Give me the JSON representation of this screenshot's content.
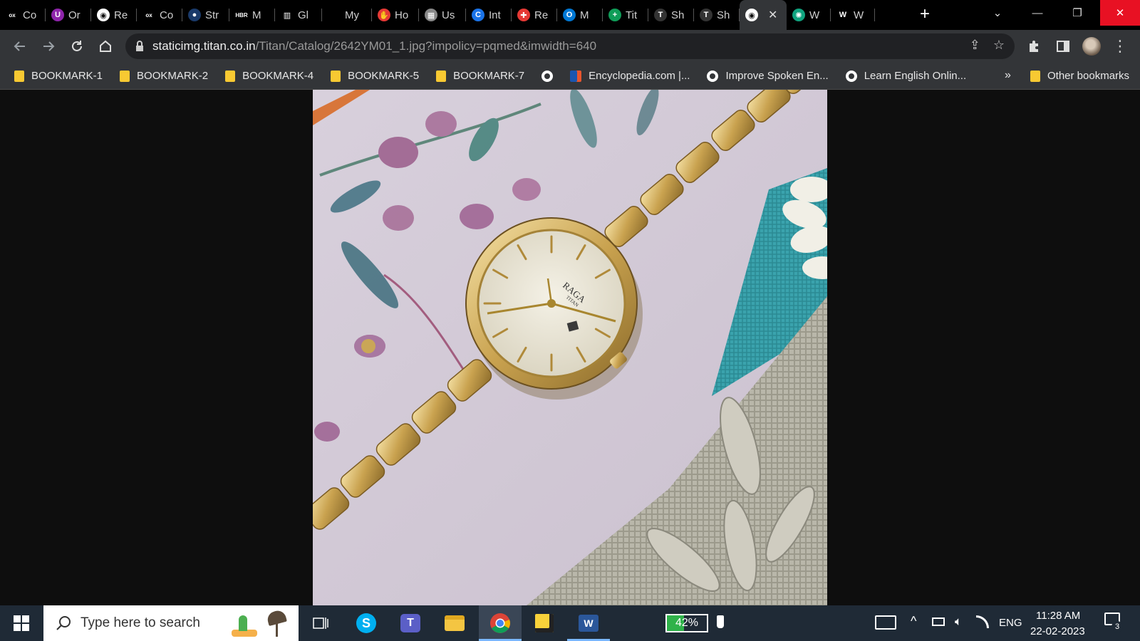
{
  "tabs": [
    {
      "label": "Co",
      "icon": "ox-icon",
      "color": "#000000"
    },
    {
      "label": "Or",
      "icon": "u-icon",
      "color": "#8e24aa"
    },
    {
      "label": "Re",
      "icon": "globe-icon",
      "color": "#ffffff"
    },
    {
      "label": "Co",
      "icon": "ox-icon",
      "color": "#000000"
    },
    {
      "label": "Str",
      "icon": "dot-icon",
      "color": "#1a3a6a"
    },
    {
      "label": "M",
      "icon": "hbr-icon",
      "color": "#000000"
    },
    {
      "label": "Gl",
      "icon": "building-icon",
      "color": "#000000"
    },
    {
      "label": "My",
      "icon": "blank-icon",
      "color": "#000000"
    },
    {
      "label": "Ho",
      "icon": "hand-icon",
      "color": "#e53935"
    },
    {
      "label": "Us",
      "icon": "image-icon",
      "color": "#888888"
    },
    {
      "label": "Int",
      "icon": "c-icon",
      "color": "#1a73e8"
    },
    {
      "label": "Re",
      "icon": "cross-icon",
      "color": "#e53935"
    },
    {
      "label": "M",
      "icon": "outlook-icon",
      "color": "#0078d4"
    },
    {
      "label": "Tit",
      "icon": "plus-icon",
      "color": "#0f9d58"
    },
    {
      "label": "Sh",
      "icon": "t-icon",
      "color": "#333333"
    },
    {
      "label": "Sh",
      "icon": "t-icon",
      "color": "#333333"
    },
    {
      "label": "",
      "icon": "globe-icon",
      "color": "#ffffff",
      "active": true
    },
    {
      "label": "W",
      "icon": "gpt-icon",
      "color": "#10a37f"
    },
    {
      "label": "W",
      "icon": "w-icon",
      "color": "#000000"
    }
  ],
  "toolbar": {
    "url_host": "staticimg.titan.co.in",
    "url_path": "/Titan/Catalog/2642YM01_1.jpg?impolicy=pqmed&imwidth=640"
  },
  "bookmarks": [
    {
      "label": "BOOKMARK-1",
      "icon": "folder-icon"
    },
    {
      "label": "BOOKMARK-2",
      "icon": "folder-icon"
    },
    {
      "label": "BOOKMARK-4",
      "icon": "folder-icon"
    },
    {
      "label": "BOOKMARK-5",
      "icon": "folder-icon"
    },
    {
      "label": "BOOKMARK-7",
      "icon": "folder-icon"
    },
    {
      "label": "",
      "icon": "globe-icon"
    },
    {
      "label": "Encyclopedia.com |...",
      "icon": "encyclopedia-icon"
    },
    {
      "label": "Improve Spoken En...",
      "icon": "globe-icon"
    },
    {
      "label": "Learn English Onlin...",
      "icon": "globe-icon"
    }
  ],
  "bookmarks_overflow": "»",
  "other_bookmarks": "Other bookmarks",
  "watch": {
    "brand": "RAGA",
    "sub": "TITAN"
  },
  "taskbar": {
    "search_placeholder": "Type here to search",
    "battery_percent": "42%",
    "battery_level": 0.42,
    "language": "ENG",
    "time": "11:28 AM",
    "date": "22-02-2023",
    "notifications": "3"
  },
  "colors": {
    "titlebar": "#000000",
    "toolbar": "#333538",
    "taskbar": "#1f2a36",
    "close_red": "#e81123",
    "folder": "#f8c932"
  }
}
